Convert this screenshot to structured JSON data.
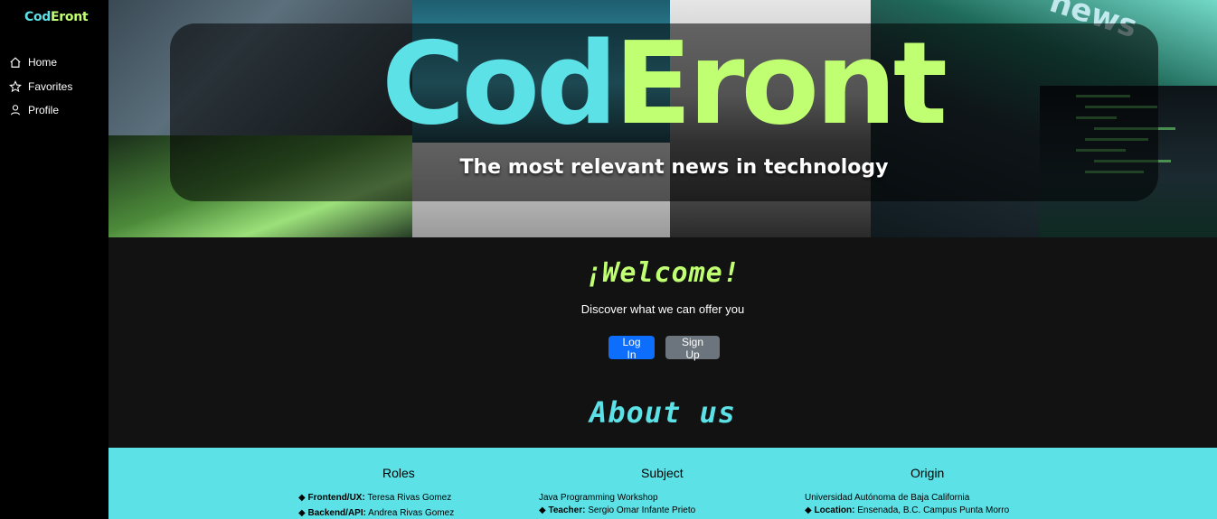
{
  "sidebar": {
    "brand_part1": "Cod",
    "brand_part2": "Eront",
    "items": [
      {
        "label": "Home",
        "icon": "home-icon"
      },
      {
        "label": "Favorites",
        "icon": "star-icon"
      },
      {
        "label": "Profile",
        "icon": "user-icon"
      }
    ]
  },
  "hero": {
    "logo_part1": "Cod",
    "logo_part2": "Eront",
    "tagline": "The most relevant news in technology",
    "sign_text": "news"
  },
  "welcome": {
    "title": "¡Welcome!",
    "subtitle": "Discover what we can offer you",
    "login_label": "Log In",
    "signup_label": "Sign Up",
    "about_title": "About us"
  },
  "info": {
    "roles": {
      "title": "Roles",
      "lines": [
        {
          "key": "Frontend/UX:",
          "value": " Teresa Rivas Gomez"
        },
        {
          "key": "Backend/API:",
          "value": " Andrea Rivas Gomez"
        }
      ]
    },
    "subject": {
      "title": "Subject",
      "line1": "Java Programming Workshop",
      "line2_key": "Teacher:",
      "line2_value": " Sergio Omar Infante Prieto"
    },
    "origin": {
      "title": "Origin",
      "line1": "Universidad Autónoma de Baja California",
      "line2_key": "Location:",
      "line2_value": " Ensenada, B.C. Campus Punta Morro"
    },
    "bullet": "◆"
  },
  "colors": {
    "cyan": "#5ce1e6",
    "lime": "#c1ff72",
    "primary": "#0d6efd",
    "secondary": "#6c757d"
  }
}
